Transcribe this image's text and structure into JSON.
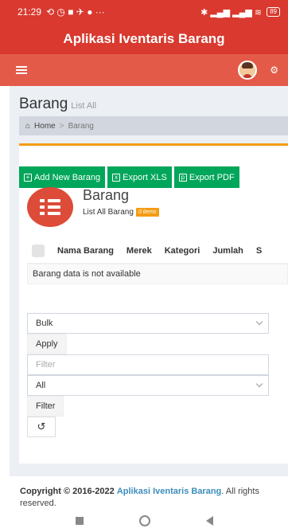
{
  "statusbar": {
    "time": "21:29",
    "icons_left": "⟲ ◷ ■ ✈ ● ···",
    "icons_right": "✱ ▂▄▆ ▂▄▆ ≋",
    "battery": "89"
  },
  "app": {
    "title": "Aplikasi Iventaris Barang"
  },
  "page": {
    "title": "Barang",
    "subtitle": "List All"
  },
  "breadcrumb": {
    "home": "Home",
    "separator": ">",
    "current": "Barang"
  },
  "toolbar": {
    "add_label": "Add New Barang",
    "export_xls_label": "Export XLS",
    "export_pdf_label": "Export PDF"
  },
  "box": {
    "title": "Barang",
    "subtitle": "List All Barang",
    "badge": "0 items"
  },
  "table": {
    "columns": [
      "Nama Barang",
      "Merek",
      "Kategori",
      "Jumlah",
      "S"
    ],
    "empty_message": "Barang data is not available"
  },
  "form": {
    "bulk_value": "Bulk",
    "apply_label": "Apply",
    "filter_placeholder": "Filter",
    "all_value": "All",
    "filter_label": "Filter",
    "reload_symbol": "↺"
  },
  "footer": {
    "copyright": "Copyright © 2016-2022",
    "app_name": "Aplikasi Iventaris Barang",
    "rights": ". All rights reserved."
  },
  "colors": {
    "primary_red": "#d9392e",
    "nav_red": "#e35a49",
    "accent_orange": "#f39c12",
    "success_green": "#00a65a",
    "link_blue": "#3c8dbc"
  }
}
